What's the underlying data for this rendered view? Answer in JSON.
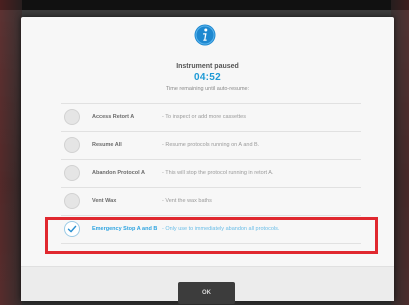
{
  "dialog": {
    "icon": "info-icon",
    "title": "Instrument paused",
    "timer": "04:52",
    "subtitle": "Time remaining until auto-resume:",
    "accent_color": "#1e9ad6",
    "highlight_color": "#e0282f"
  },
  "options": [
    {
      "label": "Access Retort A",
      "description": "- To inspect or add more cassettes",
      "selected": false
    },
    {
      "label": "Resume All",
      "description": "- Resume protocols running on A and B.",
      "selected": false
    },
    {
      "label": "Abandon Protocol A",
      "description": "- This will stop the protocol running in retort A.",
      "selected": false
    },
    {
      "label": "Vent Wax",
      "description": "- Vent the wax baths",
      "selected": false
    },
    {
      "label": "Emergency Stop A and B",
      "description": "- Only use to immediately abandon all protocols.",
      "selected": true
    }
  ],
  "footer": {
    "ok_label": "OK"
  }
}
